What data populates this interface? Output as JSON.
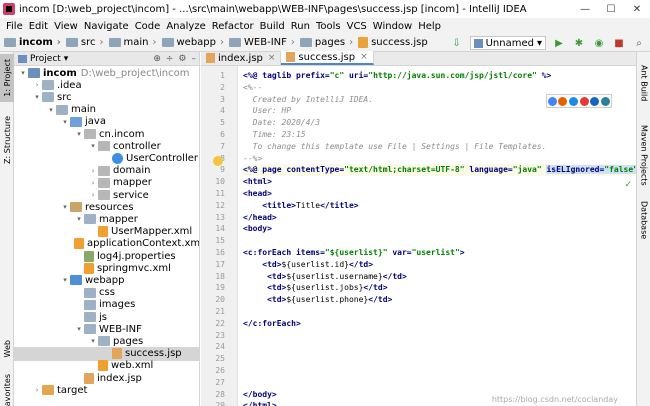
{
  "window": {
    "title": "incom [D:\\web_project\\incom] - ...\\src\\main\\webapp\\WEB-INF\\pages\\success.jsp [incom] - IntelliJ IDEA",
    "minimize": "—",
    "maximize": "☐",
    "close": "✕"
  },
  "menu": [
    "File",
    "Edit",
    "View",
    "Navigate",
    "Code",
    "Analyze",
    "Refactor",
    "Build",
    "Run",
    "Tools",
    "VCS",
    "Window",
    "Help"
  ],
  "breadcrumbs": [
    "incom",
    "src",
    "main",
    "webapp",
    "WEB-INF",
    "pages",
    "success.jsp"
  ],
  "toolbar": {
    "run_config": "Unnamed",
    "dropdown": "▾"
  },
  "project_panel": {
    "title": "Project",
    "dropdown": "▾",
    "tools": [
      "⊕",
      "÷",
      "⚙",
      "–"
    ]
  },
  "tree": [
    {
      "label": "incom",
      "path": "D:\\web_project\\incom",
      "indent": 0,
      "arrow": "▾",
      "icon": "module-icon",
      "bold": true
    },
    {
      "label": ".idea",
      "indent": 1,
      "arrow": "›",
      "icon": "folder-icon"
    },
    {
      "label": "src",
      "indent": 1,
      "arrow": "▾",
      "icon": "folder-icon"
    },
    {
      "label": "main",
      "indent": 2,
      "arrow": "▾",
      "icon": "folder-icon"
    },
    {
      "label": "java",
      "indent": 3,
      "arrow": "▾",
      "icon": "source-folder-icon"
    },
    {
      "label": "cn.incom",
      "indent": 4,
      "arrow": "▾",
      "icon": "package-icon"
    },
    {
      "label": "controller",
      "indent": 5,
      "arrow": "▾",
      "icon": "package-icon"
    },
    {
      "label": "UserController",
      "indent": 6,
      "arrow": "",
      "icon": "class-icon"
    },
    {
      "label": "domain",
      "indent": 5,
      "arrow": "›",
      "icon": "package-icon"
    },
    {
      "label": "mapper",
      "indent": 5,
      "arrow": "›",
      "icon": "package-icon"
    },
    {
      "label": "service",
      "indent": 5,
      "arrow": "›",
      "icon": "package-icon"
    },
    {
      "label": "resources",
      "indent": 3,
      "arrow": "▾",
      "icon": "resources-folder-icon"
    },
    {
      "label": "mapper",
      "indent": 4,
      "arrow": "▾",
      "icon": "folder-icon"
    },
    {
      "label": "UserMapper.xml",
      "indent": 5,
      "arrow": "",
      "icon": "xml-file-icon"
    },
    {
      "label": "applicationContext.xml",
      "indent": 4,
      "arrow": "",
      "icon": "xml-file-icon"
    },
    {
      "label": "log4j.properties",
      "indent": 4,
      "arrow": "",
      "icon": "properties-file-icon"
    },
    {
      "label": "springmvc.xml",
      "indent": 4,
      "arrow": "",
      "icon": "xml-file-icon"
    },
    {
      "label": "webapp",
      "indent": 3,
      "arrow": "▾",
      "icon": "web-folder-icon"
    },
    {
      "label": "css",
      "indent": 4,
      "arrow": "",
      "icon": "folder-icon"
    },
    {
      "label": "images",
      "indent": 4,
      "arrow": "",
      "icon": "folder-icon"
    },
    {
      "label": "js",
      "indent": 4,
      "arrow": "",
      "icon": "folder-icon"
    },
    {
      "label": "WEB-INF",
      "indent": 4,
      "arrow": "▾",
      "icon": "folder-icon"
    },
    {
      "label": "pages",
      "indent": 5,
      "arrow": "▾",
      "icon": "folder-icon"
    },
    {
      "label": "success.jsp",
      "indent": 6,
      "arrow": "",
      "icon": "jsp-file-icon",
      "selected": true
    },
    {
      "label": "web.xml",
      "indent": 5,
      "arrow": "",
      "icon": "xml-file-icon"
    },
    {
      "label": "index.jsp",
      "indent": 4,
      "arrow": "",
      "icon": "jsp-file-icon"
    },
    {
      "label": "target",
      "indent": 1,
      "arrow": "›",
      "icon": "target-folder-icon"
    }
  ],
  "left_tabs": [
    "1: Project",
    "Z: Structure",
    "Web",
    "avorites"
  ],
  "right_tabs": [
    "Ant Build",
    "Maven Projects",
    "Database"
  ],
  "editor_tabs": [
    {
      "label": "index.jsp",
      "active": false,
      "close": "×"
    },
    {
      "label": "success.jsp",
      "active": true,
      "close": "×"
    }
  ],
  "code_lines": [
    {
      "n": "1",
      "html": "<span class=\"kw\">&lt;%@ taglib prefix=</span><span class=\"str\">\"c\"</span><span class=\"kw\"> uri=</span><span class=\"str\">\"http://java.sun.com/jsp/jstl/core\"</span><span class=\"kw\"> %&gt;</span>"
    },
    {
      "n": "2",
      "html": "<span class=\"cmt\">&lt;%--</span>"
    },
    {
      "n": "3",
      "html": "<span class=\"cmt\">  Created by IntelliJ IDEA.</span>"
    },
    {
      "n": "4",
      "html": "<span class=\"cmt\">  User: HP</span>"
    },
    {
      "n": "5",
      "html": "<span class=\"cmt\">  Date: 2020/4/3</span>"
    },
    {
      "n": "6",
      "html": "<span class=\"cmt\">  Time: 23:15</span>"
    },
    {
      "n": "7",
      "html": "<span class=\"cmt\">  To change this template use File | Settings | File Templates.</span>"
    },
    {
      "n": "8",
      "html": "<span class=\"cmt\">--%&gt;</span>"
    },
    {
      "n": "9",
      "html": "<span class=\"kw\">&lt;%@ page contentType=</span><span class=\"str\">\"text/html;charset=UTF-8\"</span><span class=\"kw\"> language=</span><span class=\"str\">\"java\"</span> <span class=\"sel\"><span class=\"kw\">isELIgnored=</span><span class=\"str\">\"false\"</span></span><span class=\"kw\">%&gt;</span>",
      "highlight": true
    },
    {
      "n": "10",
      "html": "<span class=\"kw\">&lt;html&gt;</span>"
    },
    {
      "n": "11",
      "html": "<span class=\"kw\">&lt;head&gt;</span>"
    },
    {
      "n": "12",
      "html": "    <span class=\"kw\">&lt;title&gt;</span>Title<span class=\"kw\">&lt;/title&gt;</span>"
    },
    {
      "n": "13",
      "html": "<span class=\"kw\">&lt;/head&gt;</span>"
    },
    {
      "n": "14",
      "html": "<span class=\"kw\">&lt;body&gt;</span>"
    },
    {
      "n": "15",
      "html": ""
    },
    {
      "n": "16",
      "html": "<span class=\"kw\">&lt;c:forEach items=</span><span class=\"str\">\"${userlist}\"</span><span class=\"kw\"> var=</span><span class=\"str\">\"userlist\"</span><span class=\"kw\">&gt;</span>"
    },
    {
      "n": "17",
      "html": "    <span class=\"kw\">&lt;td&gt;</span>${userlist.id}<span class=\"kw\">&lt;/td&gt;</span>"
    },
    {
      "n": "18",
      "html": "     <span class=\"kw\">&lt;td&gt;</span>${userlist.username}<span class=\"kw\">&lt;/td&gt;</span>"
    },
    {
      "n": "19",
      "html": "     <span class=\"kw\">&lt;td&gt;</span>${userlist.jobs}<span class=\"kw\">&lt;/td&gt;</span>"
    },
    {
      "n": "20",
      "html": "     <span class=\"kw\">&lt;td&gt;</span>${userlist.phone}<span class=\"kw\">&lt;/td&gt;</span>"
    },
    {
      "n": "21",
      "html": ""
    },
    {
      "n": "22",
      "html": "<span class=\"kw\">&lt;/c:forEach&gt;</span>"
    },
    {
      "n": "23",
      "html": ""
    },
    {
      "n": "24",
      "html": ""
    },
    {
      "n": "25",
      "html": ""
    },
    {
      "n": "26",
      "html": ""
    },
    {
      "n": "27",
      "html": ""
    },
    {
      "n": "28",
      "html": "<span class=\"kw\">&lt;/body&gt;</span>"
    },
    {
      "n": "29",
      "html": "<span class=\"kw\">&lt;/html&gt;</span>"
    },
    {
      "n": "30",
      "html": ""
    }
  ],
  "status": {
    "check": "✓",
    "watermark": "https://blog.csdn.net/coclanday"
  },
  "colors": {
    "selection": "#cfe1f7",
    "current_line": "#fbfae6",
    "keyword": "#000080",
    "string": "#008000"
  }
}
